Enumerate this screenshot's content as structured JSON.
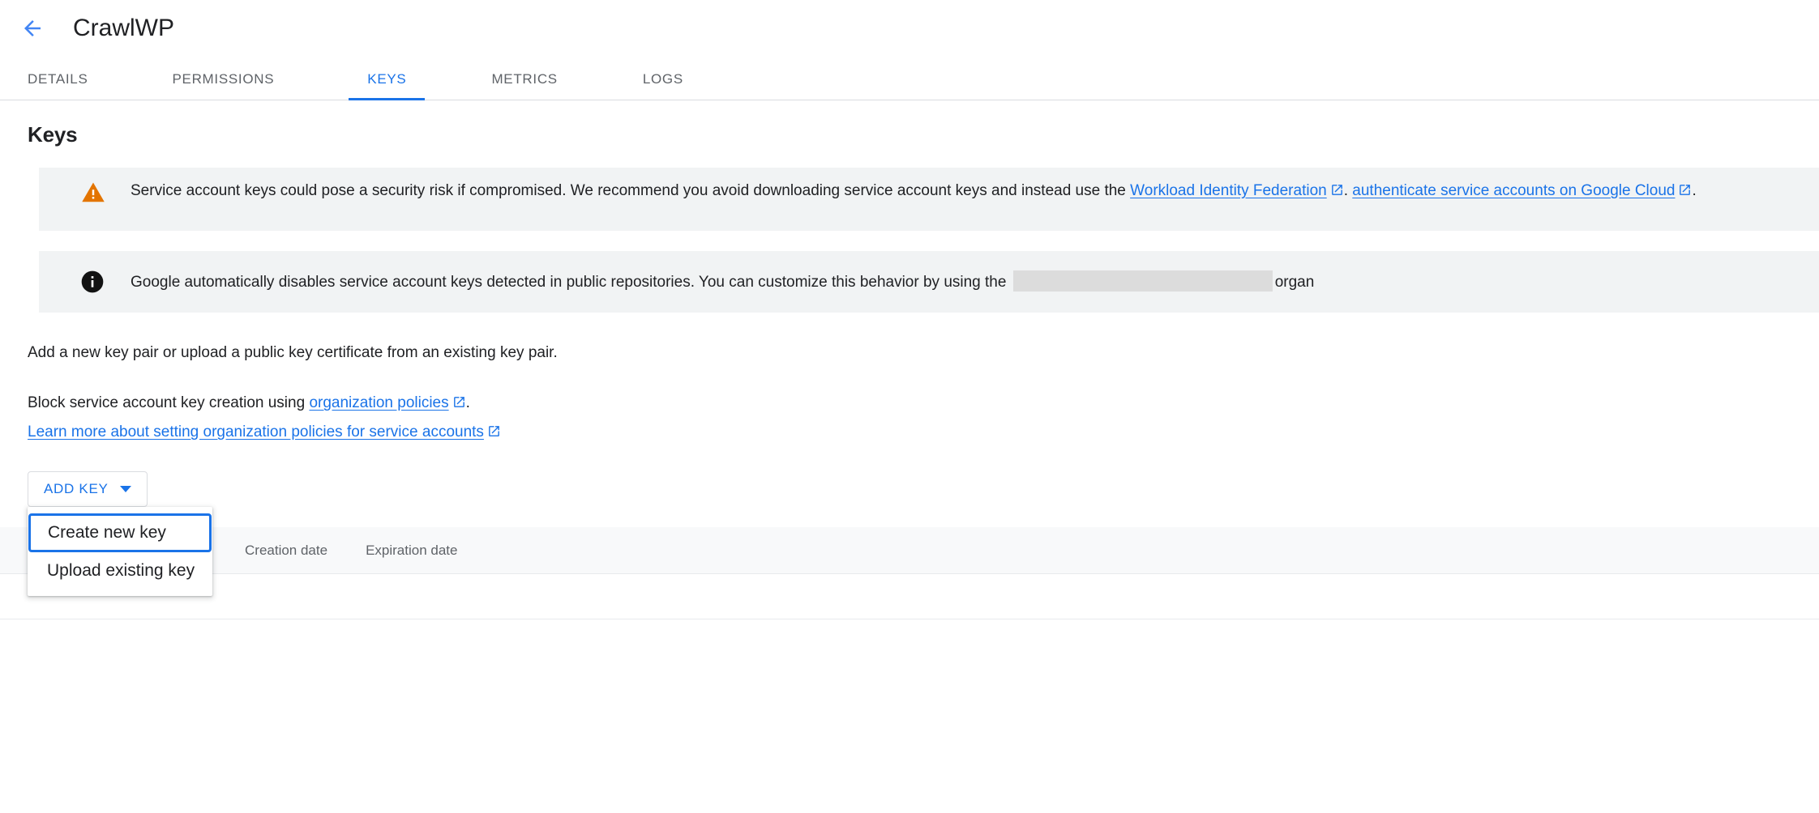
{
  "header": {
    "back_icon": "arrow-left-icon",
    "title": "CrawlWP"
  },
  "tabs": [
    {
      "label": "DETAILS",
      "active": false
    },
    {
      "label": "PERMISSIONS",
      "active": false
    },
    {
      "label": "KEYS",
      "active": true
    },
    {
      "label": "METRICS",
      "active": false
    },
    {
      "label": "LOGS",
      "active": false
    }
  ],
  "page": {
    "section_title": "Keys"
  },
  "warning_banner": {
    "icon": "warning-triangle-icon",
    "text_before_link": "Service account keys could pose a security risk if compromised. We recommend you avoid downloading service account keys and instead use the ",
    "link1": "Workload Identity Federation",
    "text_mid": ". ",
    "link2": "authenticate service accounts on Google Cloud",
    "text_after": "."
  },
  "info_banner": {
    "icon": "info-circle-icon",
    "text_before": "Google automatically disables service account keys detected in public repositories. You can customize this behavior by using the ",
    "redacted": "",
    "text_after": "organ"
  },
  "body": {
    "intro": "Add a new key pair or upload a public key certificate from an existing key pair.",
    "block_prefix": "Block service account key creation using ",
    "block_link": "organization policies",
    "block_suffix": ".",
    "learn_more_link": "Learn more about setting organization policies for service accounts"
  },
  "add_key": {
    "label": "ADD KEY",
    "caret_icon": "caret-down-icon",
    "menu": [
      {
        "label": "Create new key",
        "focused": true
      },
      {
        "label": "Upload existing key",
        "focused": false
      }
    ]
  },
  "table": {
    "columns": [
      "Creation date",
      "Expiration date"
    ],
    "rows": []
  },
  "colors": {
    "accent": "#1a73e8",
    "warning": "#e37400",
    "banner_bg": "#f1f3f4",
    "table_header_bg": "#f8f9fa",
    "text": "#202124",
    "text_secondary": "#5f6368",
    "redacted": "#dcdcdc"
  }
}
